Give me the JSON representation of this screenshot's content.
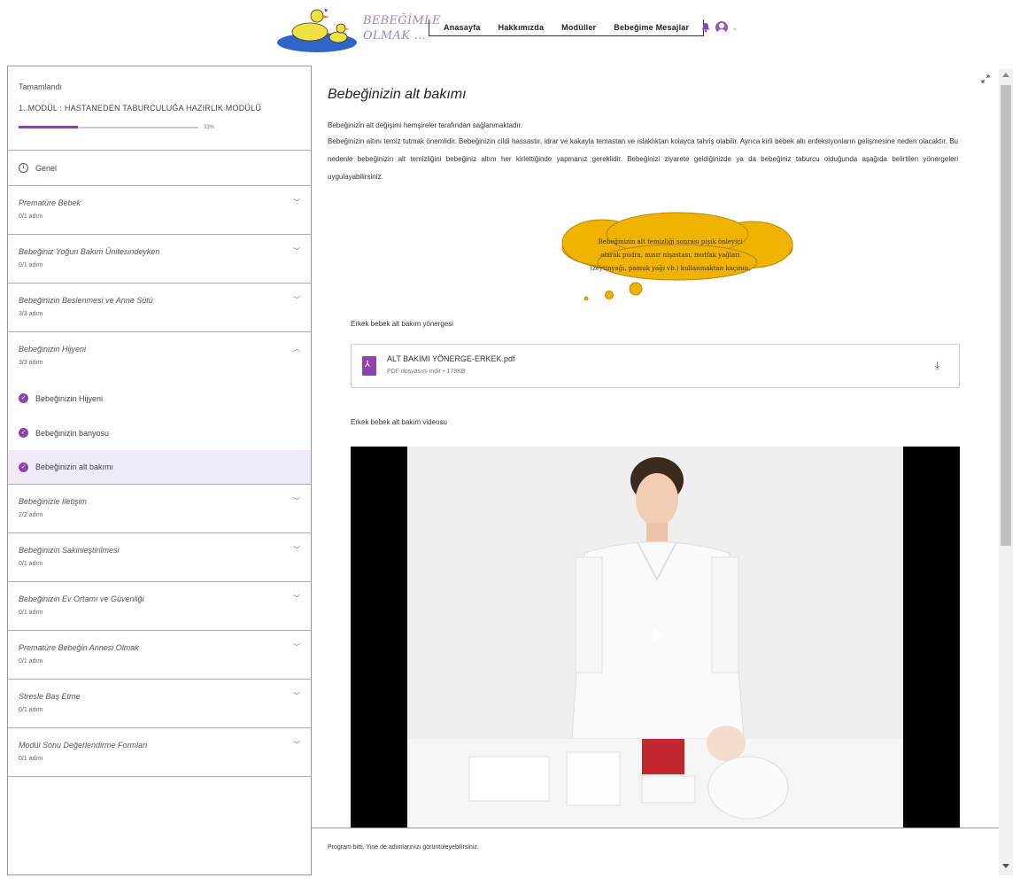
{
  "header": {
    "logo_line1": "BEBEĞİMLE",
    "logo_line2": "OLMAK ...",
    "nav": [
      "Anasayfa",
      "Hakkımızda",
      "Modüller",
      "Bebeğime Mesajlar"
    ],
    "icons": [
      "bell-icon",
      "avatar-icon",
      "chevron-down-icon"
    ]
  },
  "sidebar": {
    "status_label": "Tamamlandı",
    "module_title": "1. MODÜL : HASTANEDEN TABURCULUĞA HAZIRLIK MODÜLÜ",
    "progress_percent": 33,
    "progress_label": "33%",
    "general_label": "Genel",
    "sections_top": [
      {
        "title": "Prematüre Bebek",
        "steps": "0/1 adım"
      },
      {
        "title": "Bebeğiniz Yoğun Bakım Ünitesindeyken",
        "steps": "0/1 adım"
      },
      {
        "title": "Bebeğinizin Beslenmesi ve Anne Sütü",
        "steps": "3/3 adım"
      }
    ],
    "expanded_section": {
      "title": "Bebeğinizin Hijyeni",
      "steps": "3/3 adım"
    },
    "expanded_items": [
      {
        "label": "Bebeğinizin Hijyeni"
      },
      {
        "label": "Bebeğinizin banyosu"
      },
      {
        "label": "Bebeğinizin alt bakımı"
      }
    ],
    "sections_bottom": [
      {
        "title": "Bebeğinizle İletişim",
        "steps": "2/2 adım"
      },
      {
        "title": "Bebeğinizin Sakinleştirilmesi",
        "steps": "0/1 adım"
      },
      {
        "title": "Bebeğinizin Ev Ortamı ve Güvenliği",
        "steps": "0/1 adım"
      },
      {
        "title": "Prematüre Bebeğin Annesi Olmak",
        "steps": "0/1 adım"
      },
      {
        "title": "Stresle Baş Etme",
        "steps": "0/1 adım"
      },
      {
        "title": "Modül Sonu Değerlendirme Formları",
        "steps": "0/1 adım"
      }
    ]
  },
  "main": {
    "title": "Bebeğinizin alt bakımı",
    "paragraph1": "Bebeğinizin alt değişimi hemşireler tarafından sağlanmaktadır.",
    "paragraph2": "Bebeğinizin altını temiz tutmak önemlidir. Bebeğinizin cildi hassastır, idrar ve kakayla temastan ve ıslaklıktan kolayca tahriş olabilir. Ayrıca kirli bebek altı enfeksiyonların gelişmesine neden olacaktır. Bu nedenle bebeğinizin alt temizliğini bebeğiniz altını her kirlettiğinde yapmanız gereklidir. Bebeğinizi ziyarete geldiğinizde ya da bebeğiniz taburcu olduğunda aşağıda belirtilen yönergeleri uygulayabilirsiniz.",
    "cloud_lines": [
      "Bebeğinizin alt temizliği sonrası pişik önleyici",
      "olarak pudra, mısır nişastası, mutfak yağları",
      "(zeytinyağı, pamuk yağı vb.) kullanmaktan kaçının."
    ],
    "guide_label": "Erkek bebek alt bakım yönergesi",
    "file": {
      "name": "ALT BAKIMI YÖNERGE-ERKEK.pdf",
      "meta": "PDF dosyasını indir • 178KB"
    },
    "video_label": "Erkek bebek alt bakım videosu"
  },
  "footer": {
    "text": "Program bitti. Yine de adımlarınızı görüntüleyebilirsiniz."
  },
  "colors": {
    "accent": "#8e44ad",
    "active_bg": "#f1ebf7",
    "cloud": "#f0b400"
  }
}
